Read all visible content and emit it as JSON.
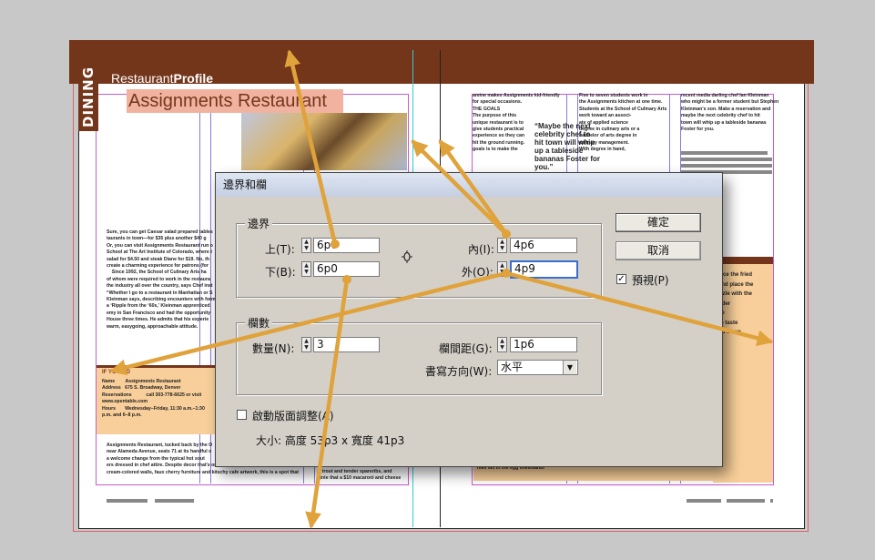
{
  "layout_page": {
    "section_tab": "DINING",
    "profile_title_light": "Restaurant",
    "profile_title_bold": "Profile",
    "restaurant_title": "Assignments Restaurant",
    "left_body_lines": [
      "Sure, you can get Caesar salad prepared tables",
      "taurants in town—for $35 plus another $40 g",
      "Or, you can visit Assignments Restaurant run o",
      "School at The Art Institute of Colorado, where t",
      "salad for $4.50 and steak Diane for $19. No, th",
      "create a charming experience for patrons (for",
      "    Since 1992, the School of Culinary Arts ha",
      "of whom were required to work in the restaura",
      "the industry all over the country, says Chef inst",
      "“Whether I go to a restaurant in Manhattan or S",
      "Kleinman says, describing encounters with form",
      "a ‘Ripple from the ‘60s,’ Kleinman apprenticed",
      "emy in San Francisco and had the opportunity",
      "House three times. He admits that his experie",
      "warm, easygoing, approachable attitude."
    ],
    "info_box_heading": "IF YOU GO",
    "info_box_lines": [
      "Name        Assignments Restaurant",
      "Address   675 S. Broadway, Denver",
      "Reservations           call 303-778-6625 or visit",
      "www.opentable.com",
      "Hours       Wednesday–Friday, 11:30 a.m.–1:30",
      "p.m. and 6–8 p.m."
    ],
    "left_bottom_lines": [
      "Assignments Restaurant, tucked back by the O",
      "near Alameda Avenue, seats 71 at its handful o",
      "a welcome change from the typical hot sout",
      "ers dressed in chef attire. Despite decor that's on the edge of institutional with its",
      "cream-colored walls, faux cherry furniture and kitschy cafe artwork, this is a spot that"
    ],
    "left_bottom_right_lines": [
      "al trout and tender spareribs, and",
      "ntrée that a $10 macaroni and cheese"
    ],
    "right_col1_lines": [
      "amine makes Assignments kid-friendly",
      "for special occasions.",
      "THE GOALS",
      "The purpose of this",
      "unique restaurant is to",
      "give students practical",
      "experience so they can",
      "hit the ground running.",
      "goals is to make the"
    ],
    "right_quote": "“Maybe the next celebrity chef to hit town will whip up a tableside bananas Foster for you.”",
    "right_col3_lines": [
      "Five to seven students work in",
      "the Assignments kitchen at one time.",
      "Students at the School of Culinary Arts",
      "work toward an associ-",
      "ate of applied science",
      "degree in culinary arts or a",
      "bachelor of arts degree in",
      "culinary management.",
      "With degree in hand,"
    ],
    "right_col4_lines": [
      "recent media darling chef Ian Kleinman",
      "who might be a former student but Stephen",
      "Kleinman's son. Make a reservation and",
      "maybe the next celebrity chef to hit",
      "town will whip up a tableside bananas",
      "Foster for you."
    ],
    "right_box_lines": [
      "lace the fried",
      "and place the",
      "izzle with the",
      "nder",
      "se",
      "to taste",
      "",
      "nd serve."
    ],
    "right_bottom_line": "mes set in the egg shell/bandi"
  },
  "dialog": {
    "title": "邊界和欄",
    "margins_group": {
      "label": "邊界",
      "top_label": "上(T):",
      "top_value": "6p0",
      "bottom_label": "下(B):",
      "bottom_value": "6p0",
      "inside_label": "內(I):",
      "inside_value": "4p6",
      "outside_label": "外(O):",
      "outside_value": "4p9",
      "link_icon": "chain-link-icon"
    },
    "columns_group": {
      "label": "欄數",
      "count_label": "數量(N):",
      "count_value": "3",
      "gutter_label": "欄間距(G):",
      "gutter_value": "1p6",
      "direction_label": "書寫方向(W):",
      "direction_value": "水平"
    },
    "layout_adjust_label": "啟動版面調整(A)",
    "layout_adjust_checked": false,
    "size_text": "大小: 高度 53p3 x 寬度 41p3",
    "ok_label": "確定",
    "cancel_label": "取消",
    "preview_label": "預視(P)",
    "preview_checked": true
  },
  "colors": {
    "banner": "#74361a",
    "highlight": "#f1b3a0",
    "box": "#f8cf9a",
    "arrow": "#e0a23a",
    "guide": "#c75bd2"
  }
}
